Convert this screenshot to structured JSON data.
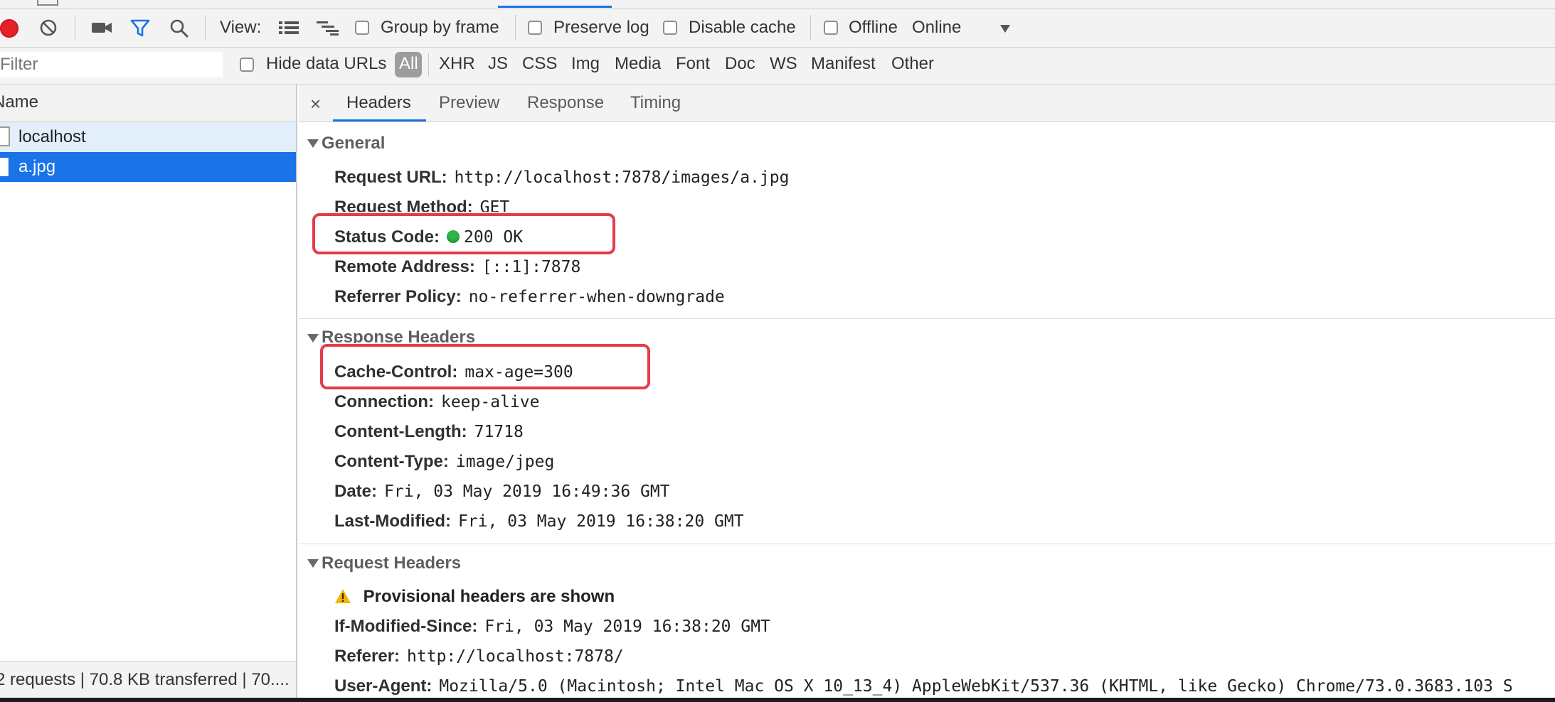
{
  "toolbar": {
    "view_label": "View:",
    "group_by_frame": "Group by frame",
    "preserve_log": "Preserve log",
    "disable_cache": "Disable cache",
    "offline": "Offline",
    "throttle_value": "Online"
  },
  "filter": {
    "placeholder": "Filter",
    "hide_data_urls": "Hide data URLs",
    "types": [
      "All",
      "XHR",
      "JS",
      "CSS",
      "Img",
      "Media",
      "Font",
      "Doc",
      "WS",
      "Manifest",
      "Other"
    ]
  },
  "requests": {
    "header": "Name",
    "items": [
      "localhost",
      "a.jpg"
    ],
    "status": "2 requests | 70.8 KB transferred | 70...."
  },
  "details": {
    "tabs": [
      "Headers",
      "Preview",
      "Response",
      "Timing"
    ],
    "general": {
      "title": "General",
      "rows": [
        {
          "k": "Request URL:",
          "v": "http://localhost:7878/images/a.jpg"
        },
        {
          "k": "Request Method:",
          "v": "GET"
        },
        {
          "k": "Status Code:",
          "v": "200 OK"
        },
        {
          "k": "Remote Address:",
          "v": "[::1]:7878"
        },
        {
          "k": "Referrer Policy:",
          "v": "no-referrer-when-downgrade"
        }
      ]
    },
    "response_headers": {
      "title": "Response Headers",
      "rows": [
        {
          "k": "Cache-Control:",
          "v": "max-age=300"
        },
        {
          "k": "Connection:",
          "v": "keep-alive"
        },
        {
          "k": "Content-Length:",
          "v": "71718"
        },
        {
          "k": "Content-Type:",
          "v": "image/jpeg"
        },
        {
          "k": "Date:",
          "v": "Fri, 03 May 2019 16:49:36 GMT"
        },
        {
          "k": "Last-Modified:",
          "v": "Fri, 03 May 2019 16:38:20 GMT"
        }
      ]
    },
    "request_headers": {
      "title": "Request Headers",
      "warning": "Provisional headers are shown",
      "rows": [
        {
          "k": "If-Modified-Since:",
          "v": "Fri, 03 May 2019 16:38:20 GMT"
        },
        {
          "k": "Referer:",
          "v": "http://localhost:7878/"
        },
        {
          "k": "User-Agent:",
          "v": "Mozilla/5.0 (Macintosh; Intel Mac OS X 10_13_4) AppleWebKit/537.36 (KHTML, like Gecko) Chrome/73.0.3683.103 S"
        }
      ]
    }
  },
  "colors": {
    "record": "#e8202a",
    "selection": "#1a73e8",
    "status_ok": "#2fb545",
    "highlight": "#e53b4b",
    "filter_blue": "#1a73e8"
  },
  "icons": [
    "record-icon",
    "clear-icon",
    "camera-icon",
    "filter-icon",
    "search-icon",
    "list-view-icon",
    "waterfall-icon",
    "dropdown-arrow-icon",
    "document-icon",
    "image-file-icon",
    "close-icon",
    "warning-icon"
  ]
}
